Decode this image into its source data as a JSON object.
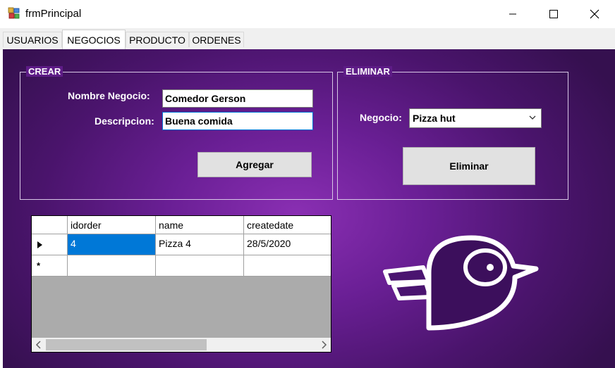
{
  "window": {
    "title": "frmPrincipal"
  },
  "tabs": [
    {
      "label": "USUARIOS"
    },
    {
      "label": "NEGOCIOS"
    },
    {
      "label": "PRODUCTO"
    },
    {
      "label": "ORDENES"
    }
  ],
  "crear": {
    "legend": "CREAR",
    "nombre_label": "Nombre Negocio:",
    "nombre_value": "Comedor Gerson",
    "descripcion_label": "Descripcion:",
    "descripcion_value": "Buena comida",
    "agregar_label": "Agregar"
  },
  "eliminar": {
    "legend": "ELIMINAR",
    "negocio_label": "Negocio:",
    "negocio_value": "Pizza hut",
    "eliminar_label": "Eliminar"
  },
  "grid": {
    "columns": [
      "idorder",
      "name",
      "createdate"
    ],
    "rows": [
      {
        "idorder": "4",
        "name": "Pizza 4",
        "createdate": "28/5/2020"
      }
    ],
    "new_row_marker": "*"
  },
  "colors": {
    "panel_bg": "#6a1f95",
    "selection": "#0078d7",
    "focus_border": "#0078d7"
  },
  "icons": [
    "app-icon",
    "minimize-icon",
    "maximize-icon",
    "close-icon",
    "chevron-down-icon",
    "row-pointer-icon",
    "scroll-left-icon",
    "scroll-right-icon",
    "bird-logo-icon"
  ]
}
